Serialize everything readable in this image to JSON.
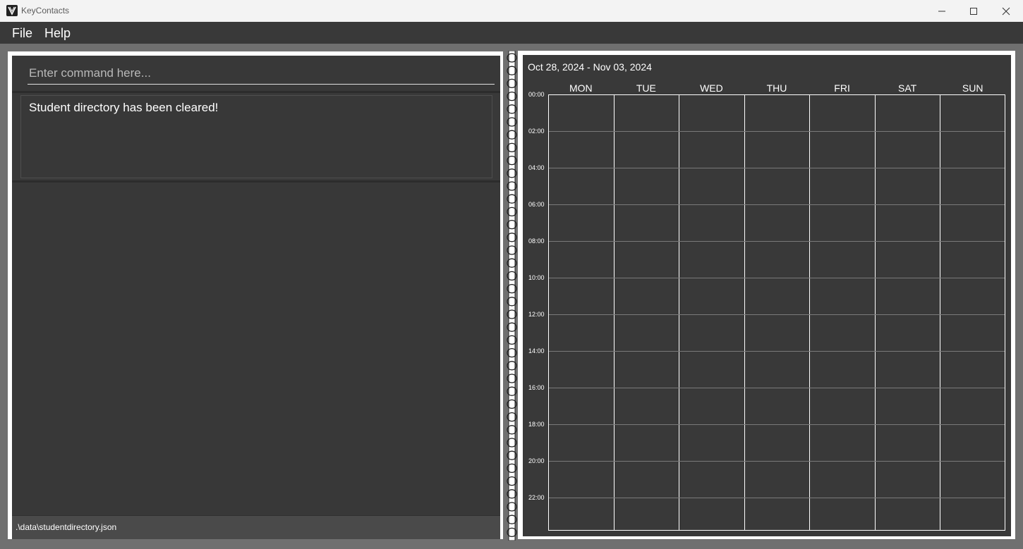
{
  "window": {
    "title": "KeyContacts"
  },
  "menu": {
    "items": [
      "File",
      "Help"
    ]
  },
  "command": {
    "placeholder": "Enter command here...",
    "value": ""
  },
  "result": {
    "message": "Student directory has been cleared!"
  },
  "status": {
    "path": ".\\data\\studentdirectory.json"
  },
  "calendar": {
    "range": "Oct 28, 2024 - Nov 03, 2024",
    "days": [
      "MON",
      "TUE",
      "WED",
      "THU",
      "FRI",
      "SAT",
      "SUN"
    ],
    "hours": [
      "00:00",
      "02:00",
      "04:00",
      "06:00",
      "08:00",
      "10:00",
      "12:00",
      "14:00",
      "16:00",
      "18:00",
      "20:00",
      "22:00"
    ]
  },
  "colors": {
    "panel": "#393939",
    "background": "#707070",
    "frame": "#ffffff"
  },
  "icons": {
    "app": "keycontacts-logo-icon",
    "minimize": "minimize-icon",
    "maximize": "maximize-icon",
    "close": "close-icon"
  }
}
